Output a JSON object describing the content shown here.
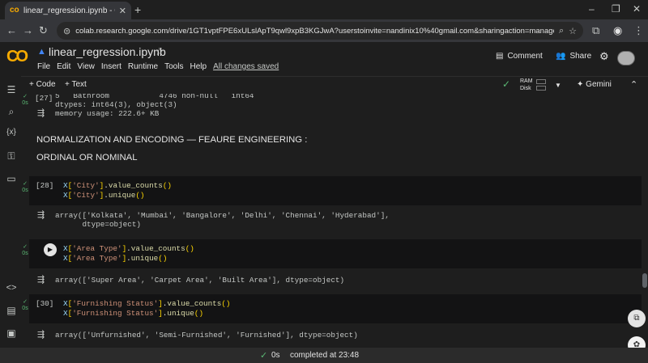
{
  "browser": {
    "tab_title": "linear_regression.ipynb - Colab",
    "url": "colab.research.google.com/drive/1GT1vptFPE6xULslApT9qwl9xpB3KGJwA?userstoinvite=nandinix10%40gmail.com&sharingaction=manageaccess&role=writer..."
  },
  "header": {
    "logo": "CO",
    "notebook_title": "linear_regression.ipynb",
    "menu": [
      "File",
      "Edit",
      "View",
      "Insert",
      "Runtime",
      "Tools",
      "Help"
    ],
    "saved_status": "All changes saved",
    "comment_label": "Comment",
    "share_label": "Share"
  },
  "toolbar": {
    "code_label": "+ Code",
    "text_label": "+ Text",
    "ram_label": "RAM",
    "disk_label": "Disk",
    "gemini_label": "Gemini"
  },
  "cells": {
    "c27": {
      "number": "[27]",
      "lines": [
        "5   Bathroom           4746 non-null   int64",
        "dtypes: int64(3), object(3)",
        "memory usage: 222.6+ KB"
      ]
    },
    "md": {
      "heading": "NORMALIZATION AND ENCODING — FEAURE ENGINEERING :",
      "sub": "ORDINAL OR NOMINAL"
    },
    "c28": {
      "number": "[28]",
      "out1": "array(['Kolkata', 'Mumbai', 'Bangalore', 'Delhi', 'Chennai', 'Hyderabad'],",
      "out2": "      dtype=object)"
    },
    "c29": {
      "out": "array(['Super Area', 'Carpet Area', 'Built Area'], dtype=object)"
    },
    "c30": {
      "number": "[30]",
      "out": "array(['Unfurnished', 'Semi-Furnished', 'Furnished'], dtype=object)"
    },
    "exec_time": "0s"
  },
  "status": {
    "time": "0s",
    "completed": "completed at 23:48"
  }
}
